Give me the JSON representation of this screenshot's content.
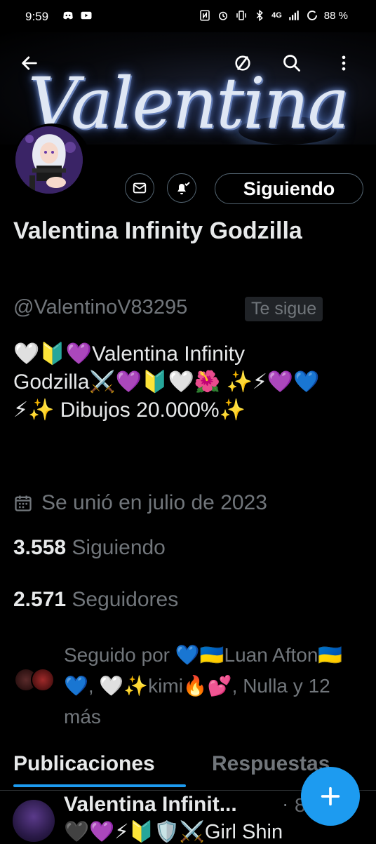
{
  "status_bar": {
    "time": "9:59",
    "network": "4G",
    "battery": "88 %"
  },
  "banner": {
    "word": "Valentina"
  },
  "header": {
    "back_icon": "arrow-left-icon",
    "grok_icon": "slash-circle-icon",
    "search_icon": "search-icon",
    "more_icon": "vertical-dots-icon"
  },
  "actions": {
    "message_icon": "envelope-icon",
    "notify_icon": "bell-check-icon",
    "follow_label": "Siguiendo"
  },
  "profile": {
    "name": "Valentina Infinity Godzilla",
    "handle": "@ValentinoV83295",
    "follows_you": "Te sigue",
    "bio": "🤍🔰💜Valentina Infinity Godzilla⚔️💜🔰🤍🌺 ✨⚡💜💙⚡✨  Dibujos 20.000%✨",
    "joined": "Se unió en julio de 2023",
    "following_count": "3.558",
    "following_label": "Siguiendo",
    "followers_count": "2.571",
    "followers_label": "Seguidores",
    "followed_by": "Seguido por 💙🇺🇦Luan Afton🇺🇦💙, 🤍✨kimi🔥💕, Nulla y 12 más"
  },
  "tabs": [
    {
      "label": "Publicaciones"
    },
    {
      "label": "Respuestas"
    }
  ],
  "post": {
    "author": "Valentina Infinit...",
    "time": "8",
    "text": "🖤💜⚡🔰🛡️⚔️Girl Shin"
  },
  "fab": {
    "icon": "plus-icon"
  },
  "colors": {
    "accent": "#1d9bf0",
    "background": "#000000",
    "text_primary": "#e7e9ea",
    "text_secondary": "#71767b"
  }
}
